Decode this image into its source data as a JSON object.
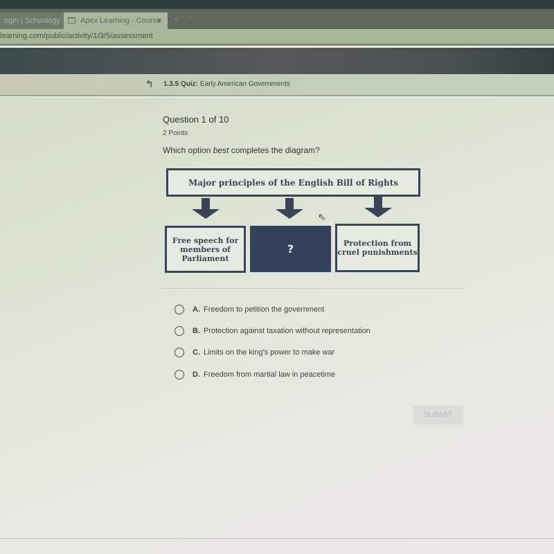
{
  "browser": {
    "tabs": [
      {
        "label": "ogin | Schoology",
        "active": false
      },
      {
        "label": "Apex Learning - Course",
        "active": true
      }
    ],
    "close_tab_icon": "×",
    "new_tab_icon": "+",
    "tab_menu_icon": "⌄",
    "url": "learning.com/public/activity/1/3/5/assessment"
  },
  "header": {
    "up_icon": "↰",
    "quiz_number": "1.3.5 Quiz:",
    "quiz_title": "Early American Governments"
  },
  "question": {
    "title": "Question 1 of 10",
    "points": "2 Points",
    "prompt_before": "Which option ",
    "prompt_emphasis": "best",
    "prompt_after": " completes the diagram?"
  },
  "diagram": {
    "top": "Major principles of the English Bill of Rights",
    "left": "Free speech for members of Parliament",
    "middle": "?",
    "right": "Protection from cruel punishments"
  },
  "options": [
    {
      "letter": "A.",
      "text": "Freedom to petition the government"
    },
    {
      "letter": "B.",
      "text": "Protection against taxation without representation"
    },
    {
      "letter": "C.",
      "text": "Limits on the king's power to make war"
    },
    {
      "letter": "D.",
      "text": "Freedom from martial law in peacetime"
    }
  ],
  "submit_label": "SUBMIT",
  "colors": {
    "diagram_navy": "#34415c",
    "submit_disabled": "#dcdddb"
  }
}
